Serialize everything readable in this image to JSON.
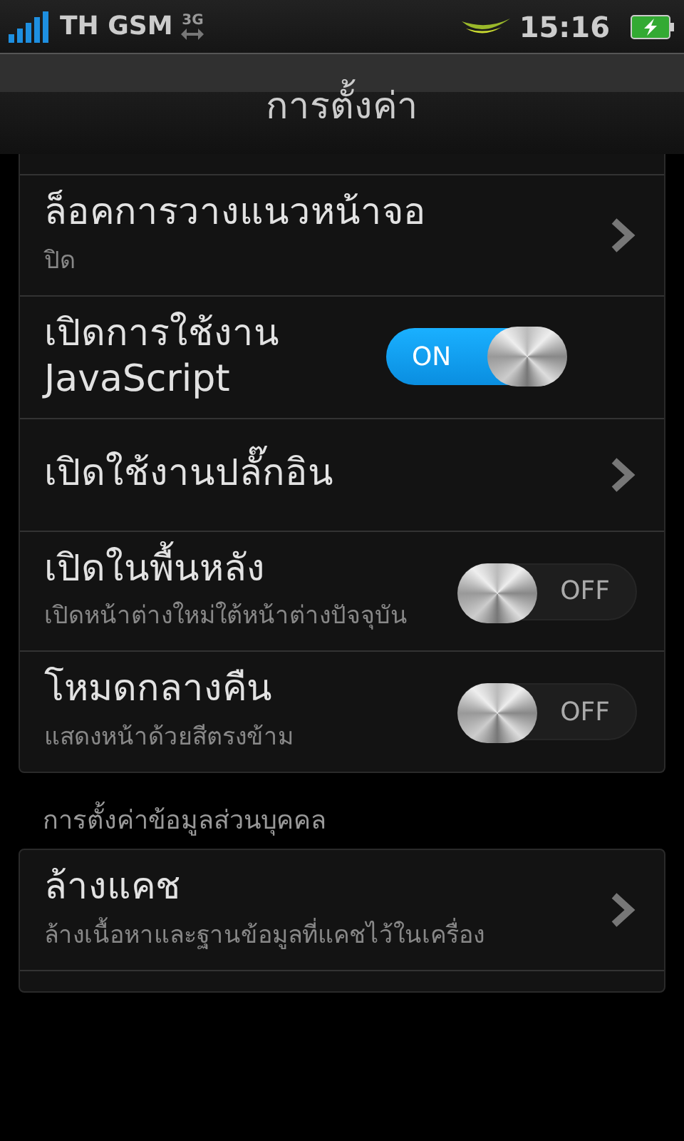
{
  "status_bar": {
    "carrier": "TH GSM",
    "network": "3G",
    "time": "15:16"
  },
  "title": "การตั้งค่า",
  "sections": [
    {
      "items": [
        {
          "kind": "stub"
        },
        {
          "kind": "link",
          "title": "ล็อคการวางแนวหน้าจอ",
          "subtitle": "ปิด"
        },
        {
          "kind": "toggle",
          "title": "เปิดการใช้งาน JavaScript",
          "on": true,
          "toggle_label": "ON"
        },
        {
          "kind": "link",
          "title": "เปิดใช้งานปลั๊กอิน"
        },
        {
          "kind": "toggle",
          "title": "เปิดในพื้นหลัง",
          "subtitle": "เปิดหน้าต่างใหม่ใต้หน้าต่างปัจจุบัน",
          "on": false,
          "toggle_label": "OFF"
        },
        {
          "kind": "toggle",
          "title": "โหมดกลางคืน",
          "subtitle": "แสดงหน้าด้วยสีตรงข้าม",
          "on": false,
          "toggle_label": "OFF"
        }
      ]
    },
    {
      "header": "การตั้งค่าข้อมูลส่วนบุคคล",
      "items": [
        {
          "kind": "link",
          "title": "ล้างแคช",
          "subtitle": "ล้างเนื้อหาและฐานข้อมูลที่แคชไว้ในเครื่อง"
        },
        {
          "kind": "stub"
        }
      ]
    }
  ]
}
